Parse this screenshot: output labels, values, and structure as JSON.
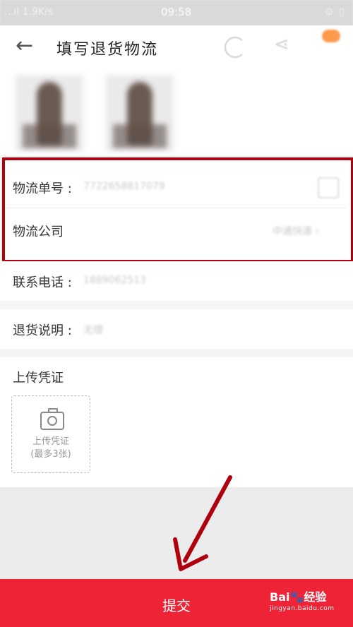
{
  "status_bar": {
    "network": "...ıl 1.9K/s",
    "time": "09:58",
    "icons": "⊙ ▯"
  },
  "header": {
    "back_icon": "←",
    "title": "填写退货物流",
    "refresh_icon": "refresh-icon",
    "share_icon": "share-icon"
  },
  "form": {
    "tracking_number": {
      "label": "物流单号",
      "colon": ":",
      "value": "7722658817079"
    },
    "courier_company": {
      "label": "物流公司",
      "value": "中通快递 ›"
    },
    "phone": {
      "label": "联系电话",
      "colon": ":",
      "value": "1889062513"
    },
    "return_note": {
      "label": "退货说明",
      "colon": ":",
      "value": "无理"
    }
  },
  "upload": {
    "title": "上传凭证",
    "box_line1": "上传凭证",
    "box_line2": "(最多3张)"
  },
  "submit": {
    "label": "提交"
  },
  "watermark": {
    "brand": "Bai🐾经验",
    "site": "jingyan.baidu.com"
  },
  "colors": {
    "highlight": "#b0000d",
    "submit": "#ef2336",
    "arrow": "#b0000d"
  }
}
